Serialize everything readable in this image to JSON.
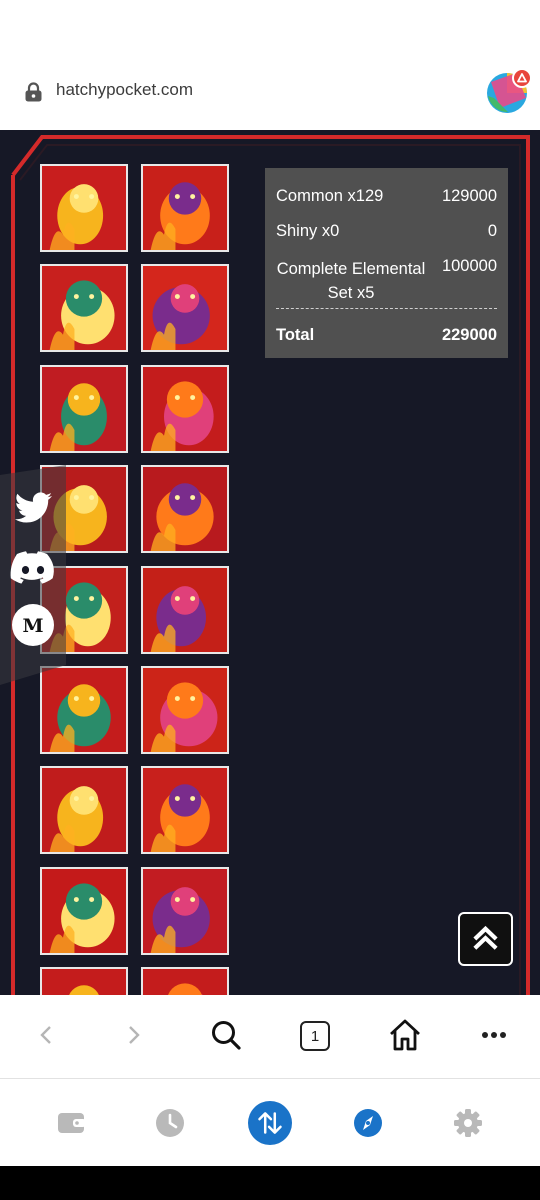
{
  "browser": {
    "url": "hatchypocket.com",
    "tabs_count": "1"
  },
  "summary": {
    "rows": [
      {
        "label": "Common x129",
        "value": "129000"
      },
      {
        "label": "Shiny x0",
        "value": "0"
      },
      {
        "label": "Complete Elemental Set x5",
        "value": "100000"
      }
    ],
    "total_label": "Total",
    "total_value": "229000"
  },
  "cards": [
    {
      "name": "fire-robot-card",
      "bg": "#c81e1e"
    },
    {
      "name": "fire-beast-card",
      "bg": "#c8201a"
    },
    {
      "name": "fire-mage-card",
      "bg": "#c8201e"
    },
    {
      "name": "fire-insect-card",
      "bg": "#d4261c"
    },
    {
      "name": "fire-lizard-card",
      "bg": "#c01c22"
    },
    {
      "name": "fire-dragon-card",
      "bg": "#c41c1c"
    },
    {
      "name": "fire-pumpkin-card",
      "bg": "#b81c1c"
    },
    {
      "name": "fire-horned-demon-card",
      "bg": "#b81a1e"
    },
    {
      "name": "fire-goat-card",
      "bg": "#c2201c"
    },
    {
      "name": "fire-mask-card",
      "bg": "#c42018"
    },
    {
      "name": "fire-serpent-card",
      "bg": "#c41c1c"
    },
    {
      "name": "fire-spirit-card",
      "bg": "#cc2418"
    },
    {
      "name": "fire-knight-card",
      "bg": "#c01c1c"
    },
    {
      "name": "fire-crab-card",
      "bg": "#c8201c"
    },
    {
      "name": "fire-mane-card",
      "bg": "#c41a1a"
    },
    {
      "name": "fire-golem-card",
      "bg": "#c21c22"
    },
    {
      "name": "fire-partial-card-1",
      "bg": "#c41c1c"
    },
    {
      "name": "fire-partial-card-2",
      "bg": "#c41c1c"
    }
  ],
  "socials": [
    "twitter-icon",
    "discord-icon",
    "medium-icon"
  ],
  "toolbar_icons": [
    "back-arrow-icon",
    "forward-arrow-icon",
    "search-icon",
    "tabs-icon",
    "home-icon",
    "more-icon"
  ],
  "wallet_icons": [
    "wallet-icon",
    "history-icon",
    "swap-icon",
    "explore-icon",
    "settings-icon"
  ],
  "colors": {
    "page_bg": "#161826",
    "frame_red": "#d42a2a",
    "accent_blue": "#1a73c8",
    "summary_bg": "#505050"
  }
}
